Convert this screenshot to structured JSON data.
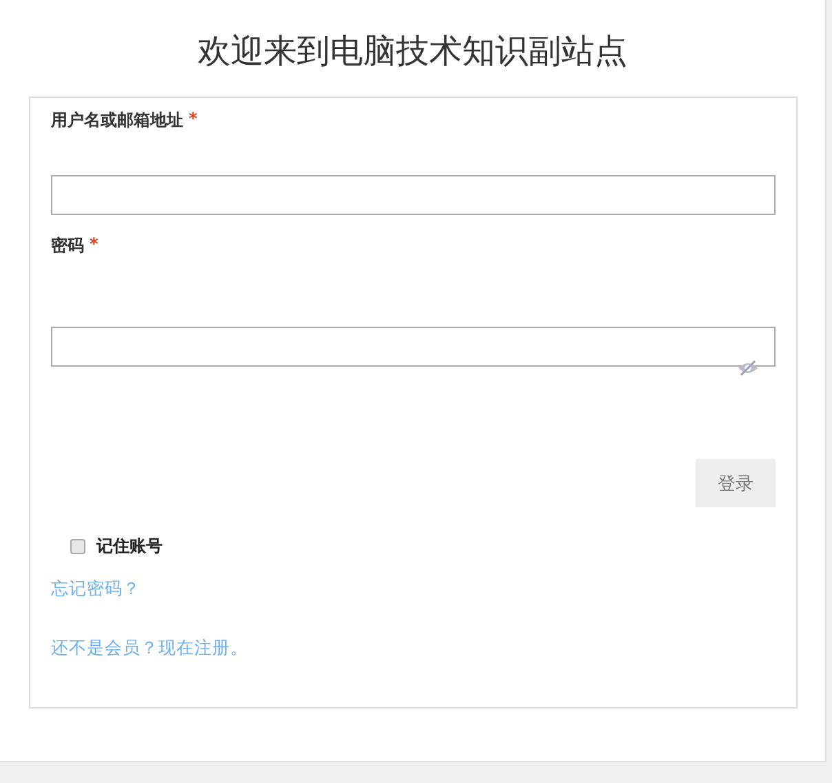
{
  "title": "欢迎来到电脑技术知识副站点",
  "fields": [
    {
      "kind": "text",
      "label": "用户名或邮箱地址",
      "required_mark": "*"
    },
    {
      "kind": "password",
      "label": "密码",
      "required_mark": "*"
    }
  ],
  "submit": "登录",
  "remember": {
    "label": "记住账号",
    "checked": false
  },
  "links": [
    "忘记密码？",
    "还不是会员？现在注册。"
  ]
}
